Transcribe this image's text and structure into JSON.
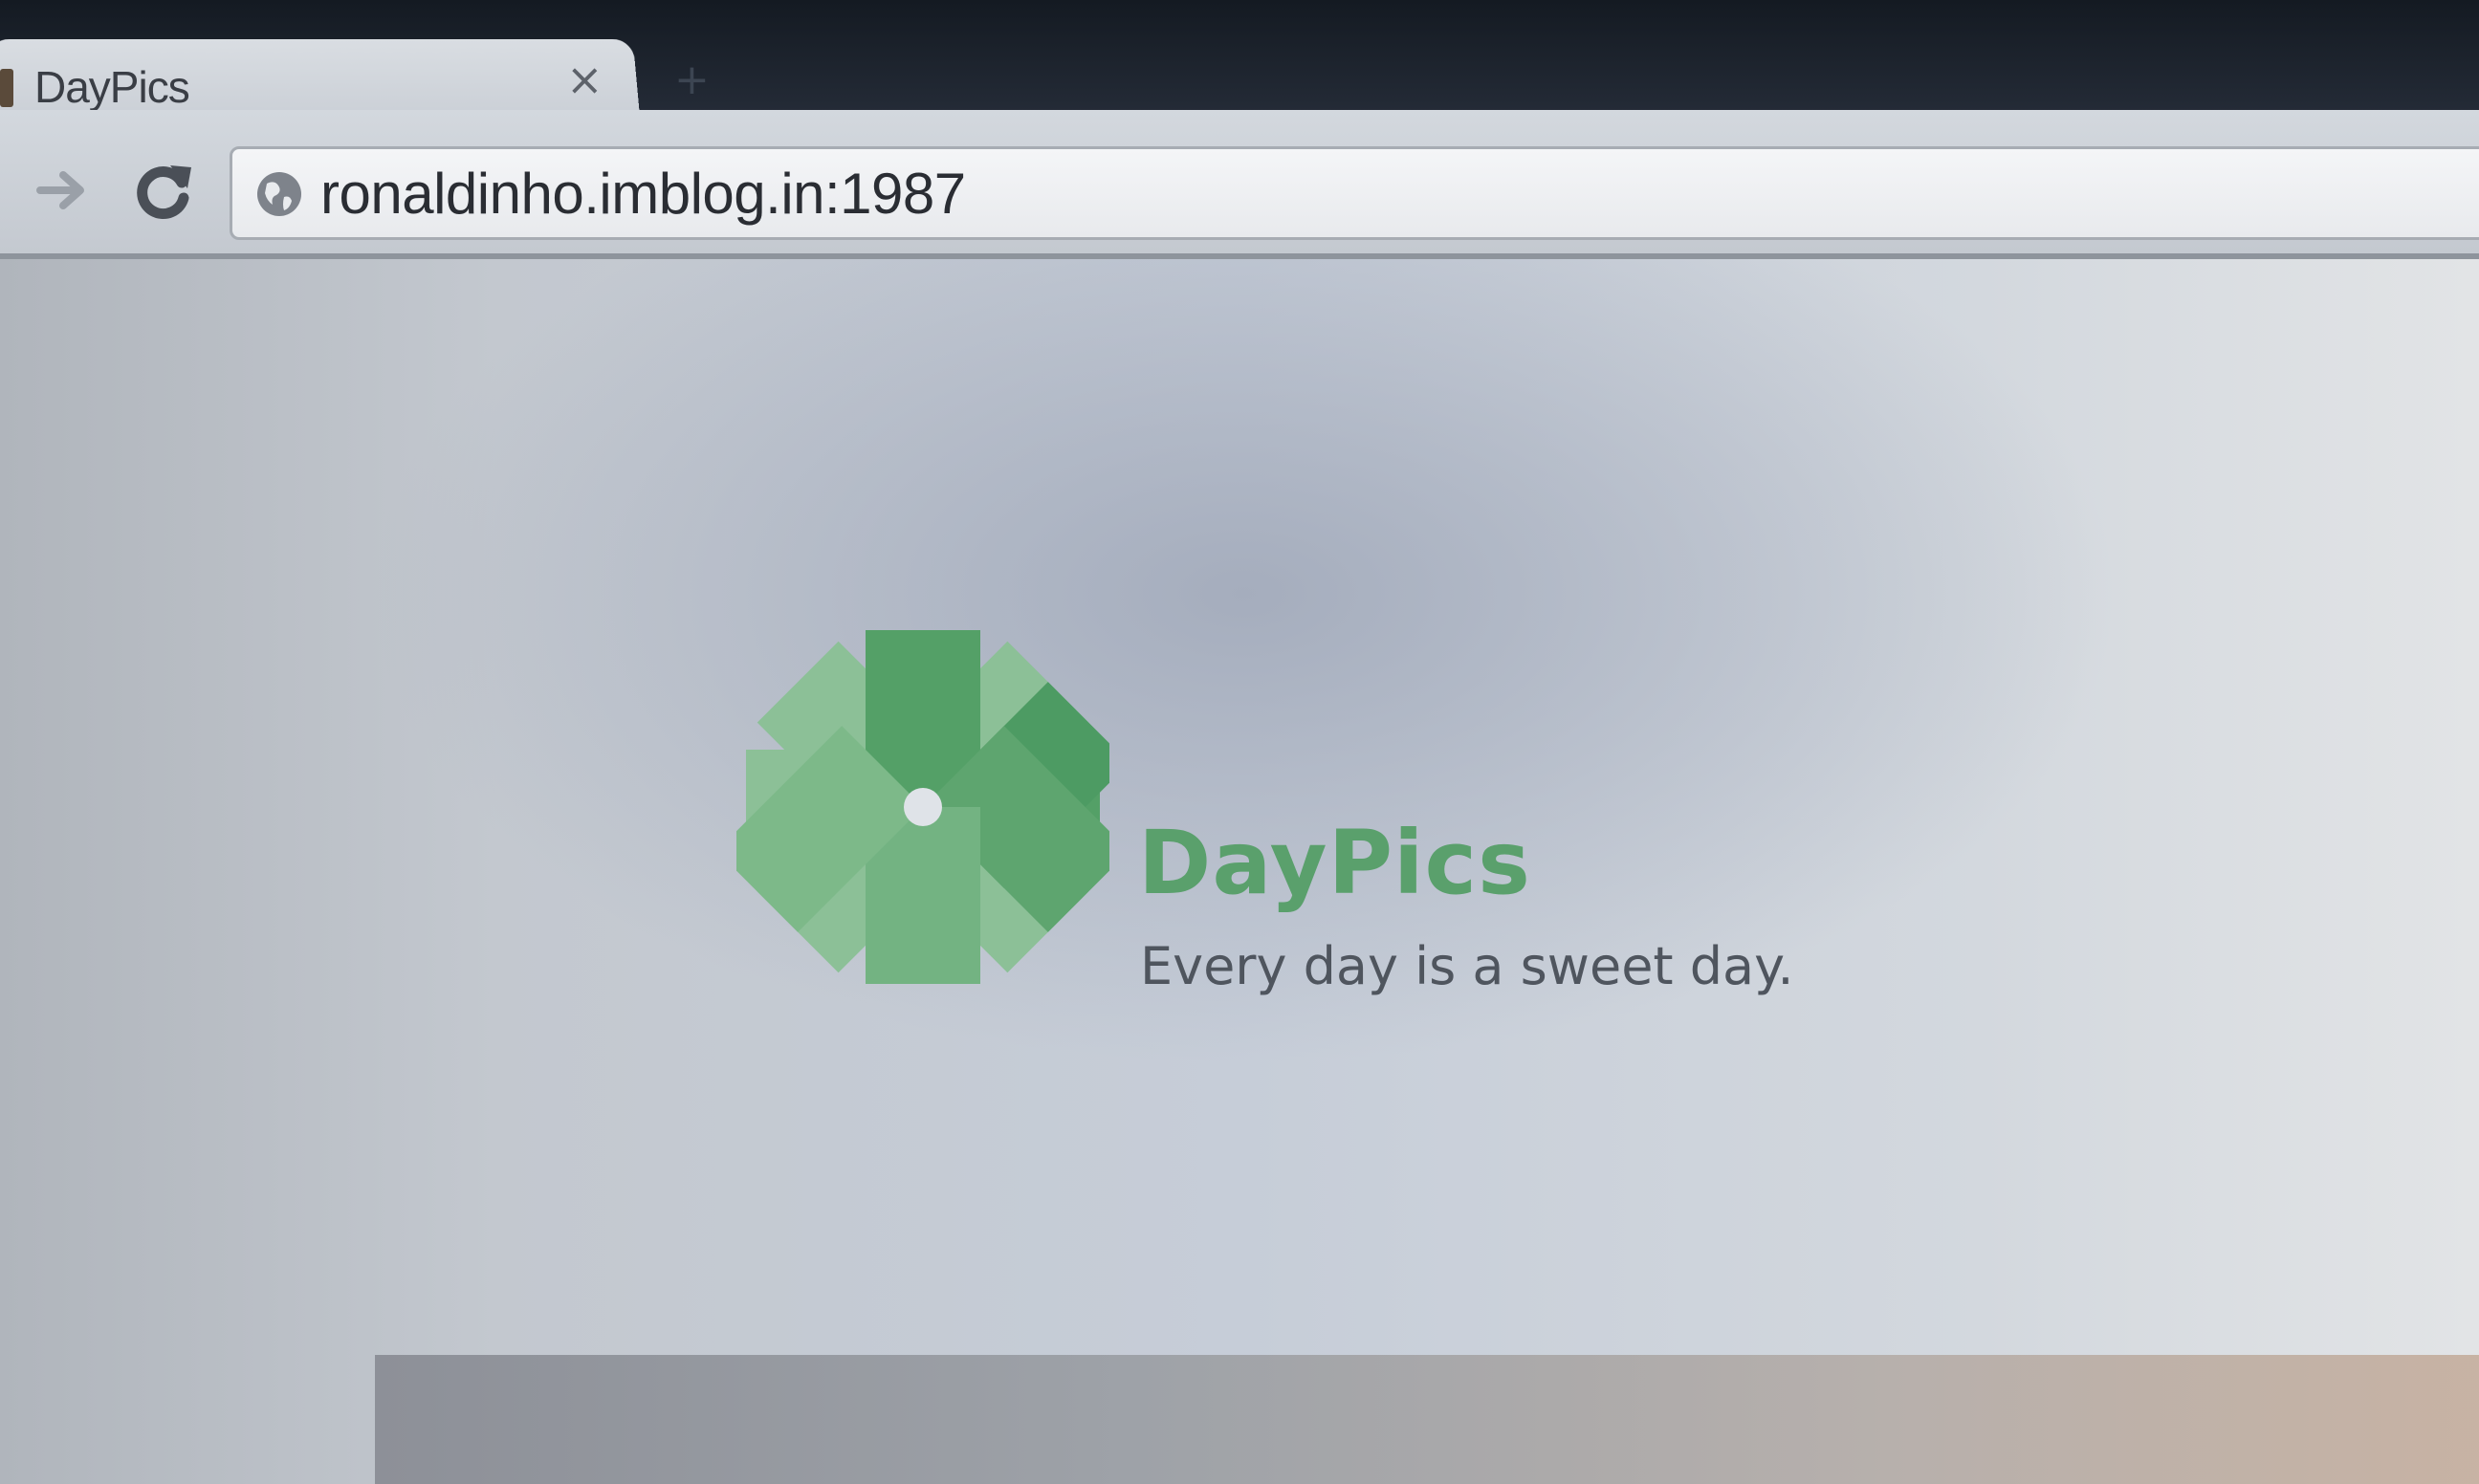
{
  "browser": {
    "tab": {
      "title": "DayPics",
      "close_icon": "close-icon",
      "close_glyph": "×"
    },
    "new_tab_glyph": "+",
    "toolbar": {
      "forward_icon": "arrow-forward-icon",
      "reload_icon": "reload-icon"
    },
    "address_bar": {
      "icon": "globe-icon",
      "url": "ronaldinho.imblog.in:1987"
    }
  },
  "page": {
    "brand": {
      "name": "DayPics",
      "tagline": "Every day is a sweet day."
    },
    "colors": {
      "brand_green": "#5aa06c",
      "brand_green_light": "#8cc097",
      "brand_green_dark": "#3f9a5c",
      "tagline_gray": "#4f555e"
    }
  }
}
